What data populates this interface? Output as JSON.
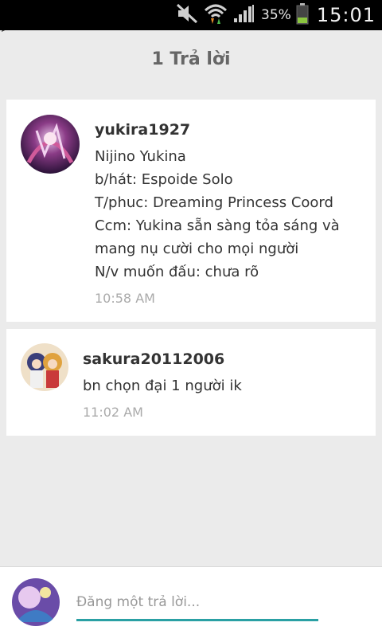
{
  "statusbar": {
    "battery_percent": "35%",
    "clock": "15:01",
    "battery_level": 0.35
  },
  "header": {
    "title": "1 Trả lời"
  },
  "posts": [
    {
      "username": "yukira1927",
      "lines": "Nijino Yukina\nb/hát: Espoide Solo\nT/phuc: Dreaming Princess Coord\nCcm: Yukina sẵn sàng tỏa sáng và mang nụ cười cho mọi người\nN/v muốn đấu: chưa rõ",
      "time": "10:58 AM"
    },
    {
      "username": "sakura20112006",
      "lines": "bn chọn đại 1 người ik",
      "time": "11:02 AM"
    }
  ],
  "composer": {
    "placeholder": "Đăng một trả lời..."
  },
  "colors": {
    "accent": "#2aa0a4",
    "background": "#ebebeb"
  }
}
